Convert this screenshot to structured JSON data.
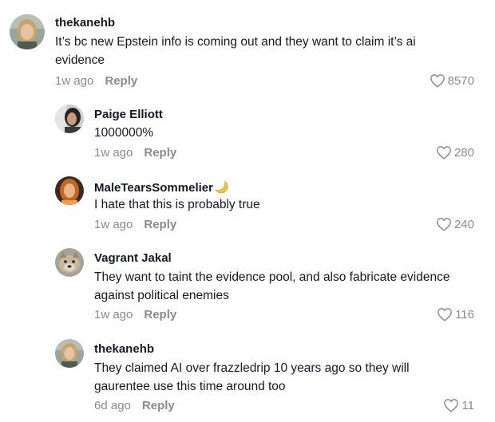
{
  "comments": [
    {
      "author": "thekanehb",
      "text": "It’s bc new Epstein info is coming out and they want to claim it’s ai evidence",
      "time": "1w ago",
      "reply": "Reply",
      "likes": "8570",
      "avatar": "woman-blonde-avatar"
    },
    {
      "author": "Paige Elliott",
      "text": "1000000%",
      "time": "1w ago",
      "reply": "Reply",
      "likes": "280",
      "avatar": "woman-dark-hair-avatar"
    },
    {
      "author": "MaleTearsSommelier",
      "author_emoji": "crescent-moon-icon",
      "text": "I hate that this is probably true",
      "time": "1w ago",
      "reply": "Reply",
      "likes": "240",
      "avatar": "woman-red-hair-avatar"
    },
    {
      "author": "Vagrant Jakal",
      "text": "They want to taint the evidence pool, and also fabricate evidence against political enemies",
      "time": "1w ago",
      "reply": "Reply",
      "likes": "116",
      "avatar": "dog-avatar"
    },
    {
      "author": "thekanehb",
      "text": "They claimed AI over frazzledrip 10 years ago so they will gaurentee use this time around too",
      "time": "6d ago",
      "reply": "Reply",
      "likes": "11",
      "avatar": "woman-blonde-avatar"
    }
  ],
  "colors": {
    "text": "#161823",
    "meta": "#8a8b91",
    "background": "#ffffff"
  }
}
